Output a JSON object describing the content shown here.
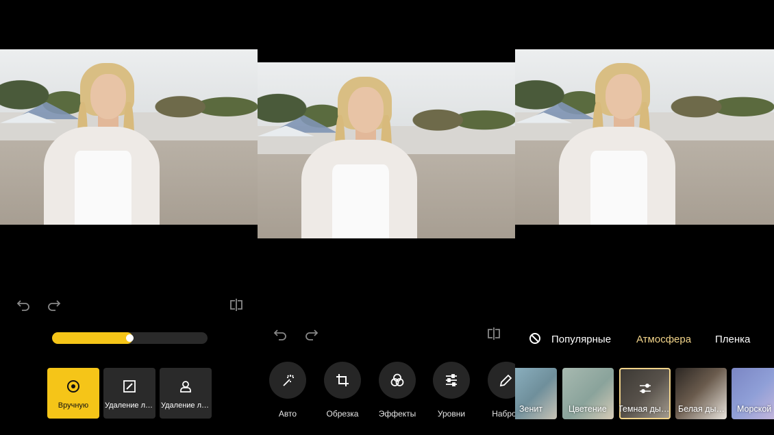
{
  "panels": {
    "manual": {
      "icons": {
        "undo": "undo-icon",
        "redo": "redo-icon",
        "compare": "compare-icon"
      },
      "slider": {
        "value_percent": 50
      },
      "modes": [
        {
          "label": "Вручную",
          "icon": "target-icon",
          "active": true
        },
        {
          "label": "Удаление лин…",
          "icon": "eraser-square-icon",
          "active": false
        },
        {
          "label": "Удаление лю…",
          "icon": "person-remove-icon",
          "active": false
        }
      ]
    },
    "tools": {
      "icons": {
        "undo": "undo-icon",
        "redo": "redo-icon",
        "compare": "compare-icon"
      },
      "items": [
        {
          "label": "Авто",
          "icon": "magic-wand-icon"
        },
        {
          "label": "Обрезка",
          "icon": "crop-icon"
        },
        {
          "label": "Эффекты",
          "icon": "effects-circles-icon"
        },
        {
          "label": "Уровни",
          "icon": "sliders-icon"
        },
        {
          "label": "Наброс",
          "icon": "pencil-icon"
        }
      ]
    },
    "filters": {
      "tabs": [
        {
          "label": "Популярные",
          "active": false
        },
        {
          "label": "Атмосфера",
          "active": true
        },
        {
          "label": "Пленка",
          "active": false
        }
      ],
      "no_filter_icon": "no-filter-icon",
      "items": [
        {
          "label": "Зенит",
          "selected": false
        },
        {
          "label": "Цветение",
          "selected": false
        },
        {
          "label": "Темная ды…",
          "selected": true,
          "icon": "adjust-sliders-icon"
        },
        {
          "label": "Белая ды…",
          "selected": false
        },
        {
          "label": "Морской",
          "selected": false
        }
      ]
    }
  },
  "colors": {
    "accent_yellow": "#f5c518",
    "tab_active": "#f2d48a",
    "button_dark": "#2a2a2a"
  }
}
